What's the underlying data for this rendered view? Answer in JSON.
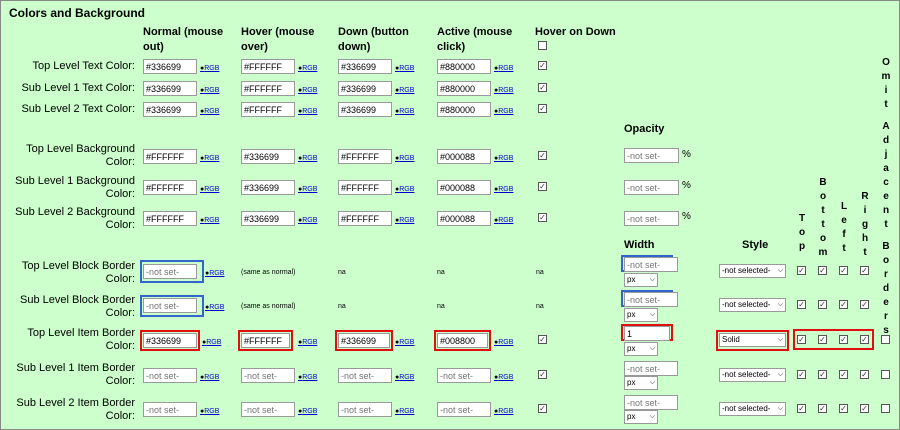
{
  "title": "Colors and Background",
  "headers": {
    "normal": "Normal (mouse out)",
    "hover": "Hover (mouse over)",
    "down": "Down (button down)",
    "active": "Active (mouse click)",
    "hover_on_down": "Hover on Down",
    "opacity": "Opacity",
    "width": "Width",
    "style": "Style",
    "top": "Top",
    "bottom": "Bottom",
    "left": "Left",
    "right": "Right",
    "omit": "Omit Adjacent Borders"
  },
  "rgb_label": "RGB",
  "same_as_normal": "(same as normal)",
  "na": "na",
  "not_set": "-not set-",
  "not_selected": "-not selected-",
  "unit": "px",
  "pct": "%",
  "rows": {
    "tl_text": {
      "label": "Top Level Text Color:",
      "normal": "#336699",
      "hover": "#FFFFFF",
      "down": "#336699",
      "active": "#880000"
    },
    "s1_text": {
      "label": "Sub Level 1 Text Color:",
      "normal": "#336699",
      "hover": "#FFFFFF",
      "down": "#336699",
      "active": "#880000"
    },
    "s2_text": {
      "label": "Sub Level 2 Text Color:",
      "normal": "#336699",
      "hover": "#FFFFFF",
      "down": "#336699",
      "active": "#880000"
    },
    "tl_bg": {
      "label": "Top Level Background Color:",
      "normal": "#FFFFFF",
      "hover": "#336699",
      "down": "#FFFFFF",
      "active": "#000088"
    },
    "s1_bg": {
      "label": "Sub Level 1 Background Color:",
      "normal": "#FFFFFF",
      "hover": "#336699",
      "down": "#FFFFFF",
      "active": "#000088"
    },
    "s2_bg": {
      "label": "Sub Level 2 Background Color:",
      "normal": "#FFFFFF",
      "hover": "#336699",
      "down": "#FFFFFF",
      "active": "#000088"
    },
    "tl_block": {
      "label": "Top Level Block Border Color:"
    },
    "s1_block": {
      "label": "Sub Level Block Border Color:"
    },
    "tl_item": {
      "label": "Top Level Item Border Color:",
      "normal": "#336699",
      "hover": "#FFFFFF",
      "down": "#336699",
      "active": "#008800",
      "width": "1",
      "style": "Solid"
    },
    "s1_item": {
      "label": "Sub Level 1 Item Border Color:"
    },
    "s2_item": {
      "label": "Sub Level 2 Item Border Color:"
    }
  },
  "colors": {
    "highlight_red": "#e01010",
    "highlight_blue": "#3366cc",
    "background": "#ccffcc"
  }
}
